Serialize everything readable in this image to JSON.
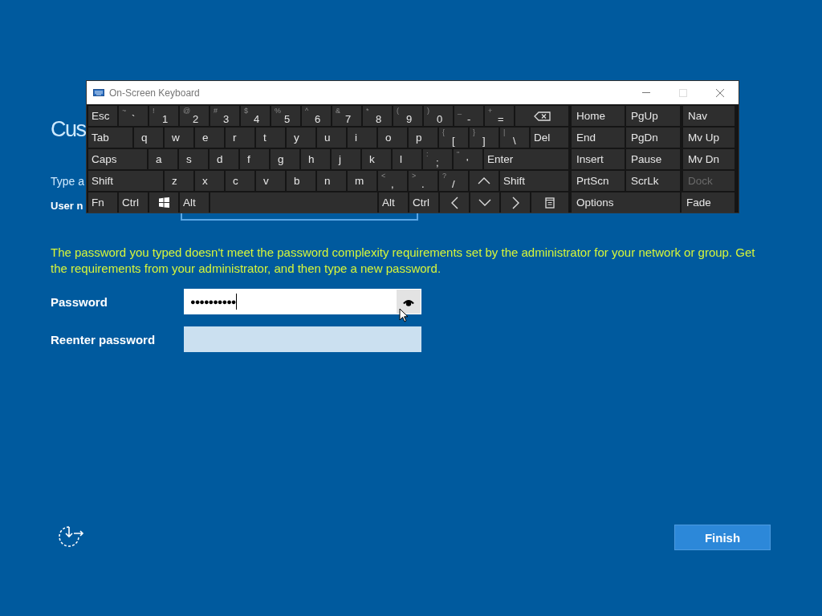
{
  "page": {
    "heading": "Cus",
    "instruction": "Type a",
    "user_name_label": "User n",
    "error": "The password you typed doesn't meet the password complexity requirements set by the administrator for your network or group. Get the requirements from your administrator, and then type a new password.",
    "password": {
      "label": "Password",
      "value": "●●●●●●●●●●"
    },
    "reenter": {
      "label": "Reenter password"
    },
    "finish": "Finish"
  },
  "keyboard": {
    "title": "On-Screen Keyboard",
    "main_rows": [
      [
        {
          "kind": "key",
          "label": "Esc"
        },
        {
          "kind": "key",
          "top": "~",
          "label": "`"
        },
        {
          "kind": "key",
          "top": "!",
          "label": "1"
        },
        {
          "kind": "key",
          "top": "@",
          "label": "2"
        },
        {
          "kind": "key",
          "top": "#",
          "label": "3"
        },
        {
          "kind": "key",
          "top": "$",
          "label": "4"
        },
        {
          "kind": "key",
          "top": "%",
          "label": "5"
        },
        {
          "kind": "key",
          "top": "^",
          "label": "6"
        },
        {
          "kind": "key",
          "top": "&",
          "label": "7"
        },
        {
          "kind": "key",
          "top": "*",
          "label": "8"
        },
        {
          "kind": "key",
          "top": "(",
          "label": "9"
        },
        {
          "kind": "key",
          "top": ")",
          "label": "0"
        },
        {
          "kind": "key",
          "top": "_",
          "label": "-"
        },
        {
          "kind": "key",
          "top": "+",
          "label": "="
        },
        {
          "kind": "backspace"
        }
      ],
      [
        {
          "kind": "key",
          "label": "Tab"
        },
        {
          "kind": "key",
          "label": "q"
        },
        {
          "kind": "key",
          "label": "w"
        },
        {
          "kind": "key",
          "label": "e"
        },
        {
          "kind": "key",
          "label": "r"
        },
        {
          "kind": "key",
          "label": "t"
        },
        {
          "kind": "key",
          "label": "y"
        },
        {
          "kind": "key",
          "label": "u"
        },
        {
          "kind": "key",
          "label": "i"
        },
        {
          "kind": "key",
          "label": "o"
        },
        {
          "kind": "key",
          "label": "p"
        },
        {
          "kind": "key",
          "top": "{",
          "label": "["
        },
        {
          "kind": "key",
          "top": "}",
          "label": "]"
        },
        {
          "kind": "key",
          "top": "|",
          "label": "\\"
        },
        {
          "kind": "key",
          "label": "Del"
        }
      ],
      [
        {
          "kind": "key",
          "label": "Caps"
        },
        {
          "kind": "key",
          "label": "a"
        },
        {
          "kind": "key",
          "label": "s"
        },
        {
          "kind": "key",
          "label": "d"
        },
        {
          "kind": "key",
          "label": "f"
        },
        {
          "kind": "key",
          "label": "g"
        },
        {
          "kind": "key",
          "label": "h"
        },
        {
          "kind": "key",
          "label": "j"
        },
        {
          "kind": "key",
          "label": "k"
        },
        {
          "kind": "key",
          "label": "l"
        },
        {
          "kind": "key",
          "top": ":",
          "label": ";"
        },
        {
          "kind": "key",
          "top": "\"",
          "label": "'"
        },
        {
          "kind": "key",
          "label": "Enter"
        }
      ],
      [
        {
          "kind": "key",
          "label": "Shift"
        },
        {
          "kind": "key",
          "label": "z"
        },
        {
          "kind": "key",
          "label": "x"
        },
        {
          "kind": "key",
          "label": "c"
        },
        {
          "kind": "key",
          "label": "v"
        },
        {
          "kind": "key",
          "label": "b"
        },
        {
          "kind": "key",
          "label": "n"
        },
        {
          "kind": "key",
          "label": "m"
        },
        {
          "kind": "key",
          "top": "<",
          "label": ","
        },
        {
          "kind": "key",
          "top": ">",
          "label": "."
        },
        {
          "kind": "key",
          "top": "?",
          "label": "/"
        },
        {
          "kind": "up"
        },
        {
          "kind": "key",
          "label": "Shift"
        }
      ],
      [
        {
          "kind": "key",
          "label": "Fn"
        },
        {
          "kind": "key",
          "label": "Ctrl"
        },
        {
          "kind": "windows"
        },
        {
          "kind": "key",
          "label": "Alt"
        },
        {
          "kind": "space"
        },
        {
          "kind": "key",
          "label": "Alt"
        },
        {
          "kind": "key",
          "label": "Ctrl"
        },
        {
          "kind": "left"
        },
        {
          "kind": "down"
        },
        {
          "kind": "right"
        },
        {
          "kind": "menu"
        }
      ]
    ],
    "side_keys": [
      {
        "kind": "key",
        "label": "Home",
        "disabled": false
      },
      {
        "kind": "key",
        "label": "PgUp",
        "disabled": false
      },
      {
        "kind": "key",
        "label": "Nav",
        "disabled": false
      },
      {
        "kind": "key",
        "label": "End",
        "disabled": false
      },
      {
        "kind": "key",
        "label": "PgDn",
        "disabled": false
      },
      {
        "kind": "key",
        "label": "Mv Up",
        "disabled": false
      },
      {
        "kind": "key",
        "label": "Insert",
        "disabled": false
      },
      {
        "kind": "key",
        "label": "Pause",
        "disabled": false
      },
      {
        "kind": "key",
        "label": "Mv Dn",
        "disabled": false
      },
      {
        "kind": "key",
        "label": "PrtScn",
        "disabled": false
      },
      {
        "kind": "key",
        "label": "ScrLk",
        "disabled": false
      },
      {
        "kind": "key",
        "label": "Dock",
        "disabled": true
      },
      {
        "kind": "wide",
        "label": "Options",
        "disabled": false
      },
      {
        "kind": "key",
        "label": "Fade",
        "disabled": false
      }
    ]
  }
}
